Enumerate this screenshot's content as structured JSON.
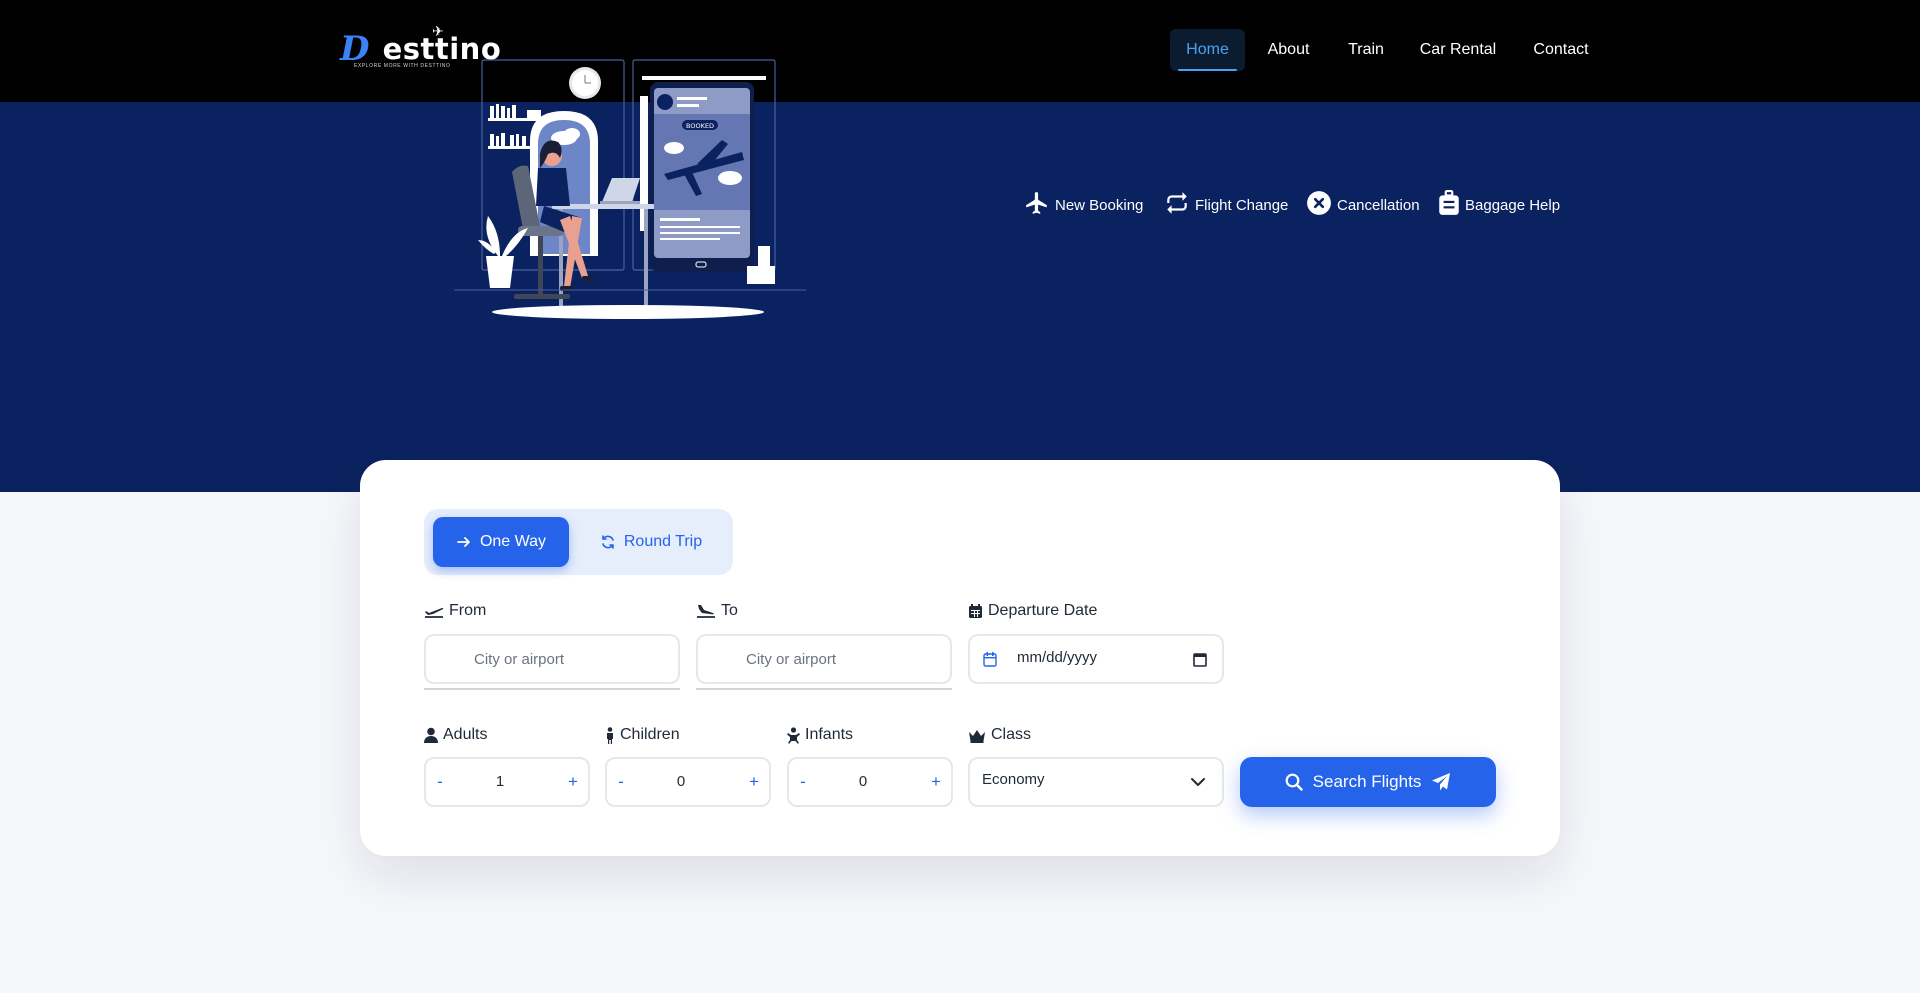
{
  "brand": {
    "logo_initial": "D",
    "logo_rest": "esttino",
    "tagline": "EXPLORE MORE WITH DESTTINO"
  },
  "nav": {
    "items": [
      {
        "label": "Home",
        "active": true
      },
      {
        "label": "About"
      },
      {
        "label": "Train"
      },
      {
        "label": "Car Rental"
      },
      {
        "label": "Contact"
      }
    ]
  },
  "hero": {
    "illustration_badge": "BOOKED",
    "services": [
      {
        "label": "New Booking",
        "icon": "plane-icon"
      },
      {
        "label": "Flight Change",
        "icon": "repeat-icon"
      },
      {
        "label": "Cancellation",
        "icon": "cancel-circle-icon"
      },
      {
        "label": "Baggage Help",
        "icon": "suitcase-icon"
      }
    ]
  },
  "search": {
    "trip_types": [
      {
        "label": "One Way",
        "icon": "arrow-right-icon",
        "active": true
      },
      {
        "label": "Round Trip",
        "icon": "sync-icon",
        "active": false
      }
    ],
    "from": {
      "label": "From",
      "placeholder": "City or airport",
      "value": ""
    },
    "to": {
      "label": "To",
      "placeholder": "City or airport",
      "value": ""
    },
    "departure": {
      "label": "Departure Date",
      "placeholder": "mm/dd/yyyy"
    },
    "adults": {
      "label": "Adults",
      "value": "1",
      "minus": "-",
      "plus": "+"
    },
    "children": {
      "label": "Children",
      "value": "0",
      "minus": "-",
      "plus": "+"
    },
    "infants": {
      "label": "Infants",
      "value": "0",
      "minus": "-",
      "plus": "+"
    },
    "class": {
      "label": "Class",
      "value": "Economy"
    },
    "submit_label": "Search Flights"
  },
  "colors": {
    "nav_bg": "#000000",
    "hero_bg": "#0b2260",
    "accent": "#2563eb",
    "active_nav": "#4aa3f0",
    "page_bg": "#f5f7fb"
  }
}
